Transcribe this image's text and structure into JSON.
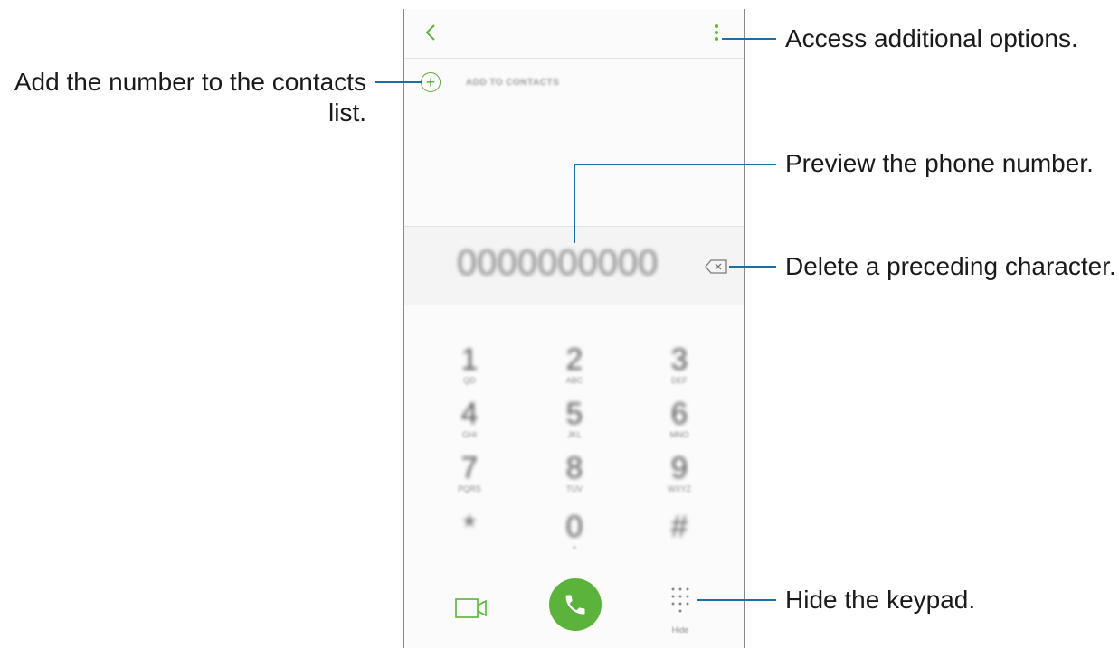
{
  "phone": {
    "add_contacts_label": "ADD TO CONTACTS",
    "number_preview": "0000000000",
    "hide_label": "Hide",
    "accent_color": "#5cb33b",
    "icons": {
      "back": "chevron-left-icon",
      "more": "more-vertical-icon",
      "add": "plus-circle-icon",
      "delete": "backspace-icon",
      "video": "video-call-icon",
      "call": "phone-icon",
      "keypad": "keypad-dots-icon"
    },
    "keys": [
      {
        "digit": "1",
        "letters": "QD"
      },
      {
        "digit": "2",
        "letters": "ABC"
      },
      {
        "digit": "3",
        "letters": "DEF"
      },
      {
        "digit": "4",
        "letters": "GHI"
      },
      {
        "digit": "5",
        "letters": "JKL"
      },
      {
        "digit": "6",
        "letters": "MNO"
      },
      {
        "digit": "7",
        "letters": "PQRS"
      },
      {
        "digit": "8",
        "letters": "TUV"
      },
      {
        "digit": "9",
        "letters": "WXYZ"
      },
      {
        "digit": "*",
        "letters": ""
      },
      {
        "digit": "0",
        "letters": "+"
      },
      {
        "digit": "#",
        "letters": ""
      }
    ]
  },
  "callouts": {
    "add_contacts_line1": "Add the number to the contacts",
    "add_contacts_line2": "list.",
    "more_options": "Access additional options.",
    "preview": "Preview the phone number.",
    "delete": "Delete a preceding character.",
    "hide_keypad": "Hide the keypad.",
    "line_color": "#1a6fa6"
  }
}
